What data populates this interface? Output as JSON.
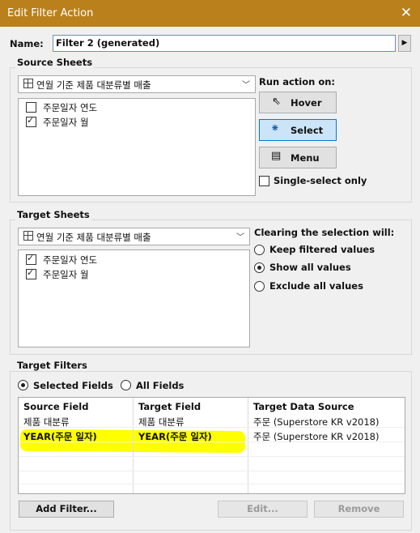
{
  "window": {
    "title": "Edit Filter Action",
    "close_glyph": "✕"
  },
  "name_field": {
    "label": "Name:",
    "value": "Filter 2 (generated)",
    "arrow": "▶"
  },
  "source_sheets": {
    "title": "Source Sheets",
    "combo_value": "연월 기준 제품 대분류별 매출",
    "items": [
      {
        "label": "주문일자 연도",
        "checked": false
      },
      {
        "label": "주문일자 월",
        "checked": true
      }
    ]
  },
  "run_action": {
    "label": "Run action on:",
    "buttons": [
      {
        "label": "Hover",
        "icon": "pointer-icon",
        "selected": false
      },
      {
        "label": "Select",
        "icon": "click-pointer-icon",
        "selected": true
      },
      {
        "label": "Menu",
        "icon": "menu-pointer-icon",
        "selected": false
      }
    ],
    "single_select": {
      "label": "Single-select only",
      "checked": false
    }
  },
  "target_sheets": {
    "title": "Target Sheets",
    "combo_value": "연월 기준 제품 대분류별 매출",
    "items": [
      {
        "label": "주문일자 연도",
        "checked": true
      },
      {
        "label": "주문일자 월",
        "checked": true
      }
    ]
  },
  "clearing": {
    "label": "Clearing the selection will:",
    "options": [
      {
        "label": "Keep filtered values",
        "selected": false
      },
      {
        "label": "Show all values",
        "selected": true
      },
      {
        "label": "Exclude all values",
        "selected": false
      }
    ]
  },
  "target_filters": {
    "title": "Target Filters",
    "options": [
      {
        "label": "Selected Fields",
        "selected": true
      },
      {
        "label": "All Fields",
        "selected": false
      }
    ],
    "columns": [
      "Source Field",
      "Target Field",
      "Target Data Source"
    ],
    "rows": [
      [
        "제품 대분류",
        "제품 대분류",
        "주문 (Superstore KR v2018)"
      ],
      [
        "YEAR(주문 일자)",
        "YEAR(주문 일자)",
        "주문 (Superstore KR v2018)"
      ]
    ],
    "highlight_color": "#ffff00"
  },
  "buttons": {
    "add_filter": "Add Filter...",
    "edit": "Edit...",
    "remove": "Remove"
  }
}
